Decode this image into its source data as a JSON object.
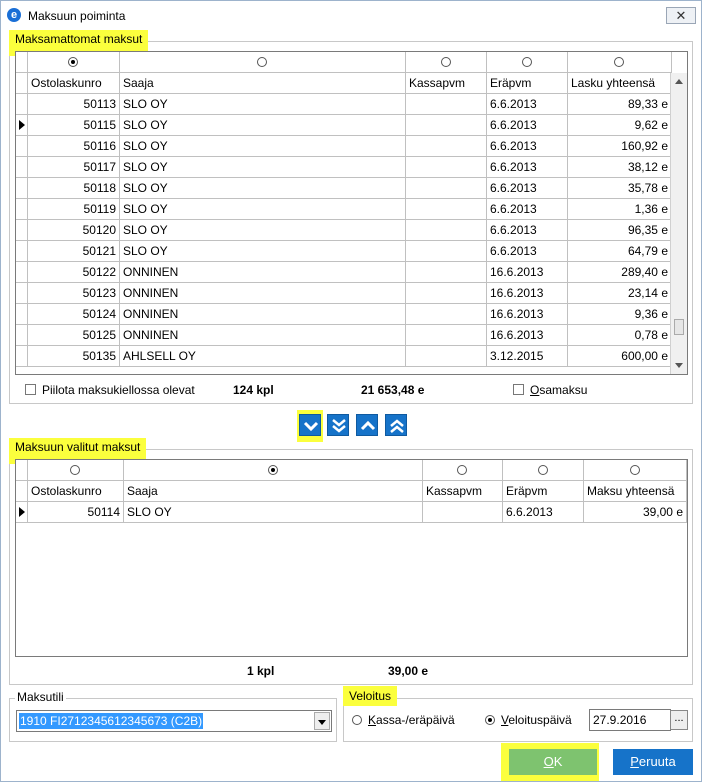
{
  "window": {
    "title": "Maksuun poiminta",
    "icon_letter": "e",
    "close_glyph": "✕"
  },
  "unpaid": {
    "group_label": "Maksamattomat maksut",
    "columns": [
      "Ostolaskunro",
      "Saaja",
      "Kassapvm",
      "Eräpvm",
      "Lasku yhteensä"
    ],
    "selected_sort_column": 0,
    "rows": [
      {
        "no": "50113",
        "payee": "SLO OY",
        "cash_date": "",
        "due": "6.6.2013",
        "total": "89,33 e"
      },
      {
        "no": "50115",
        "payee": "SLO OY",
        "cash_date": "",
        "due": "6.6.2013",
        "total": "9,62 e"
      },
      {
        "no": "50116",
        "payee": "SLO OY",
        "cash_date": "",
        "due": "6.6.2013",
        "total": "160,92 e"
      },
      {
        "no": "50117",
        "payee": "SLO OY",
        "cash_date": "",
        "due": "6.6.2013",
        "total": "38,12 e"
      },
      {
        "no": "50118",
        "payee": "SLO OY",
        "cash_date": "",
        "due": "6.6.2013",
        "total": "35,78 e"
      },
      {
        "no": "50119",
        "payee": "SLO OY",
        "cash_date": "",
        "due": "6.6.2013",
        "total": "1,36 e"
      },
      {
        "no": "50120",
        "payee": "SLO OY",
        "cash_date": "",
        "due": "6.6.2013",
        "total": "96,35 e"
      },
      {
        "no": "50121",
        "payee": "SLO OY",
        "cash_date": "",
        "due": "6.6.2013",
        "total": "64,79 e"
      },
      {
        "no": "50122",
        "payee": "ONNINEN",
        "cash_date": "",
        "due": "16.6.2013",
        "total": "289,40 e"
      },
      {
        "no": "50123",
        "payee": "ONNINEN",
        "cash_date": "",
        "due": "16.6.2013",
        "total": "23,14 e"
      },
      {
        "no": "50124",
        "payee": "ONNINEN",
        "cash_date": "",
        "due": "16.6.2013",
        "total": "9,36 e"
      },
      {
        "no": "50125",
        "payee": "ONNINEN",
        "cash_date": "",
        "due": "16.6.2013",
        "total": "0,78 e"
      },
      {
        "no": "50135",
        "payee": "AHLSELL OY",
        "cash_date": "",
        "due": "3.12.2015",
        "total": "600,00 e"
      }
    ],
    "current_row": 1,
    "hide_blocked_label": "Piilota maksukiellossa olevat",
    "count": "124 kpl",
    "sum": "21 653,48 e",
    "partial_label": "Osamaksu",
    "partial_label_underline": "O",
    "partial_label_rest": "samaksu"
  },
  "move_buttons": [
    {
      "name": "move-down-one-button",
      "icon": "chevron-down"
    },
    {
      "name": "move-down-all-button",
      "icon": "double-chevron-down"
    },
    {
      "name": "move-up-one-button",
      "icon": "chevron-up"
    },
    {
      "name": "move-up-all-button",
      "icon": "double-chevron-up"
    }
  ],
  "selected": {
    "group_label": "Maksuun valitut maksut",
    "columns": [
      "Ostolaskunro",
      "Saaja",
      "Kassapvm",
      "Eräpvm",
      "Maksu yhteensä"
    ],
    "selected_sort_column": 1,
    "rows": [
      {
        "no": "50114",
        "payee": "SLO OY",
        "cash_date": "",
        "due": "6.6.2013",
        "total": "39,00 e"
      }
    ],
    "count": "1 kpl",
    "sum": "39,00 e"
  },
  "account": {
    "group_label": "Maksutili",
    "value": "1910 FI2712345612345673 (C2B)"
  },
  "charge": {
    "group_label": "Veloitus",
    "option_due": "Kassa-/eräpäivä",
    "option_due_underline": "K",
    "option_due_rest": "assa-/eräpäivä",
    "option_date": "Veloituspäivä",
    "option_date_underline": "V",
    "option_date_rest": "eloituspäivä",
    "selected": "date",
    "date_value": "27.9.2016",
    "date_button": "..."
  },
  "buttons": {
    "ok": "OK",
    "ok_underline": "O",
    "ok_rest": "K",
    "cancel": "Peruuta",
    "cancel_underline": "P",
    "cancel_rest": "eruuta"
  },
  "colors": {
    "highlight": "#fbff3d",
    "accent_blue": "#1673c9",
    "ok_green": "#7ec36f",
    "selection_blue": "#3399ff"
  }
}
